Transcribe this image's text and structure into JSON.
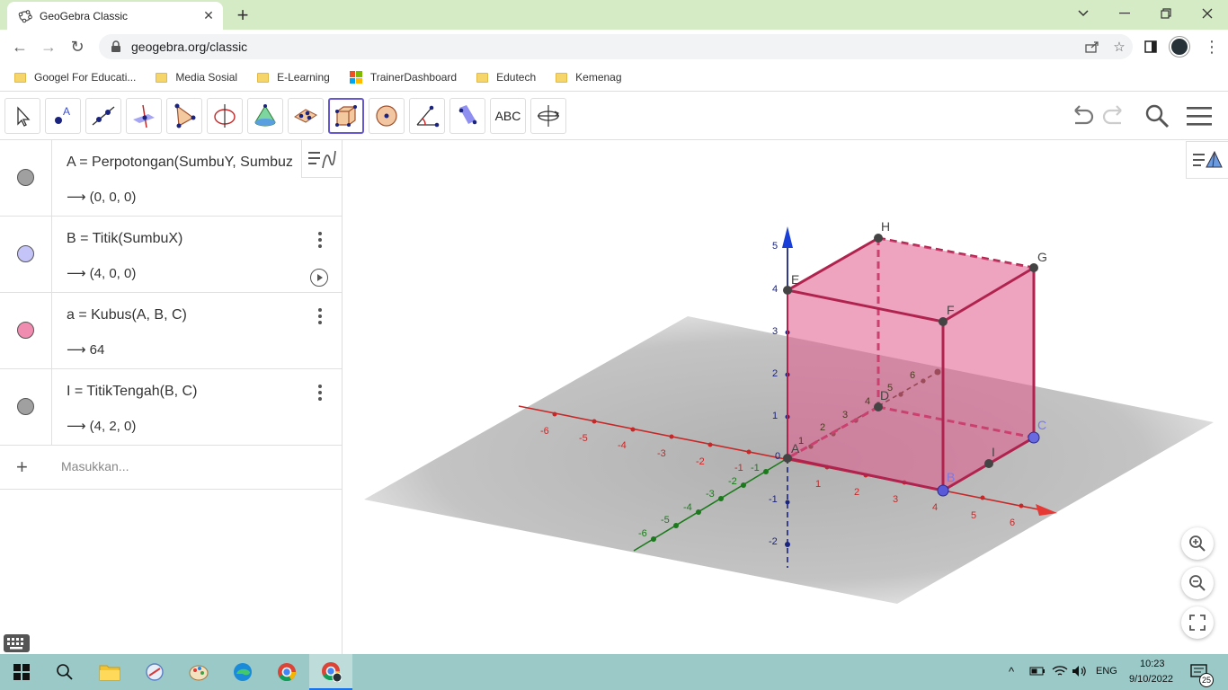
{
  "browser": {
    "tab_title": "GeoGebra Classic",
    "url": "geogebra.org/classic",
    "bookmarks": [
      "Googel For Educati...",
      "Media Sosial",
      "E-Learning",
      "TrainerDashboard",
      "Edutech",
      "Kemenag"
    ]
  },
  "toolbar": {
    "text_tool_label": "ABC"
  },
  "algebra": {
    "rows": [
      {
        "definition": "A = Perpotongan(SumbuY, Sumbuz",
        "value": "⟶ (0, 0, 0)",
        "color": "#a0a0a0"
      },
      {
        "definition": "B = Titik(SumbuX)",
        "value": "⟶ (4, 0, 0)",
        "color": "#c4c4f8"
      },
      {
        "definition": "a = Kubus(A, B, C)",
        "value": "⟶ 64",
        "color": "#f08cb0"
      },
      {
        "definition": "I = TitikTengah(B, C)",
        "value": "⟶ (4, 2, 0)",
        "color": "#a0a0a0"
      }
    ],
    "input_placeholder": "Masukkan..."
  },
  "graphics": {
    "cube_color": "#d6336c",
    "point_labels": {
      "A": "A",
      "B": "B",
      "C": "C",
      "D": "D",
      "E": "E",
      "F": "F",
      "G": "G",
      "H": "H",
      "I": "I"
    },
    "x_ticks": [
      "-6",
      "-5",
      "-4",
      "-3",
      "-2",
      "-1",
      "1",
      "2",
      "3",
      "4",
      "5",
      "6"
    ],
    "y_ticks": [
      "-6",
      "-5",
      "-4",
      "-3",
      "-2",
      "-1",
      "1",
      "2",
      "3",
      "4",
      "5",
      "6"
    ],
    "z_ticks": [
      "5",
      "4",
      "3",
      "2",
      "1",
      "0",
      "-1",
      "-2"
    ]
  },
  "taskbar": {
    "lang": "ENG",
    "time": "10:23",
    "date": "9/10/2022",
    "notifications": "25"
  }
}
